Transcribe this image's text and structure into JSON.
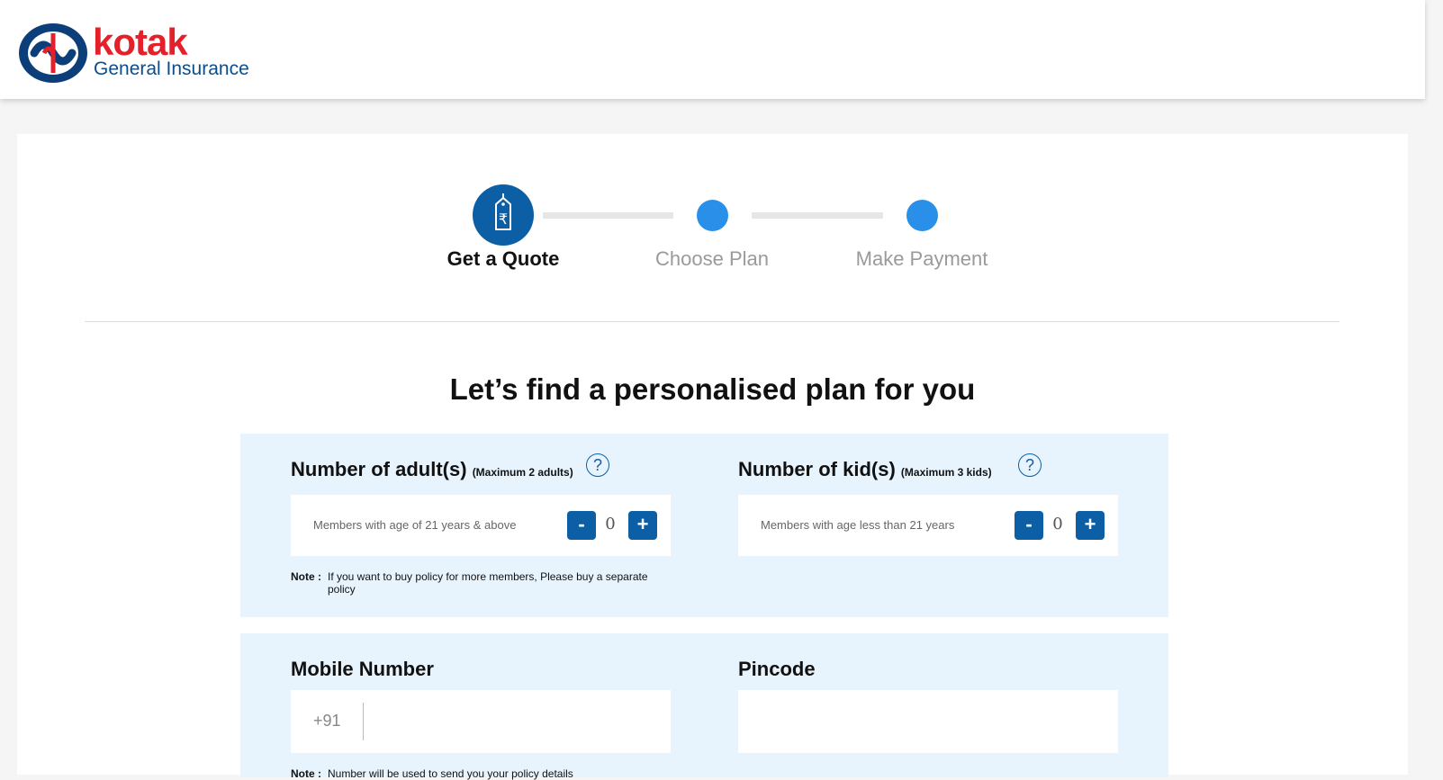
{
  "logo": {
    "wordmark": "kotak",
    "subtitle": "General Insurance",
    "colors": {
      "brand_red": "#e4202a",
      "brand_blue": "#0c4d8c"
    }
  },
  "stepper": {
    "steps": [
      {
        "label": "Get a Quote",
        "icon": "price-tag-rupee-icon",
        "active": true
      },
      {
        "label": "Choose Plan",
        "active": false
      },
      {
        "label": "Make Payment",
        "active": false
      }
    ],
    "colors": {
      "active": "#0c5ea5",
      "pending": "#2a8fe8",
      "track": "#e6e6e6"
    }
  },
  "main": {
    "title": "Let’s find a personalised plan for you"
  },
  "members": {
    "adults": {
      "title": "Number of adult(s)",
      "max_note": "(Maximum 2 adults)",
      "hint": "Members with age of 21 years & above",
      "count": "0",
      "minus": "-",
      "plus": "+",
      "help": "?"
    },
    "kids": {
      "title": "Number of kid(s)",
      "max_note": "(Maximum 3 kids)",
      "hint": "Members with age less than 21 years",
      "count": "0",
      "minus": "-",
      "plus": "+",
      "help": "?"
    },
    "note_label": "Note :",
    "note_text": "If you want to buy policy for more members, Please buy a separate policy"
  },
  "contact": {
    "mobile_title": "Mobile Number",
    "mobile_prefix": "+91",
    "mobile_value": "",
    "pincode_title": "Pincode",
    "pincode_value": "",
    "note_label": "Note :",
    "note_text": "Number will be used to send you your policy details"
  },
  "colors": {
    "panel_bg": "#e8f4fd",
    "button": "#0c5ea5"
  }
}
